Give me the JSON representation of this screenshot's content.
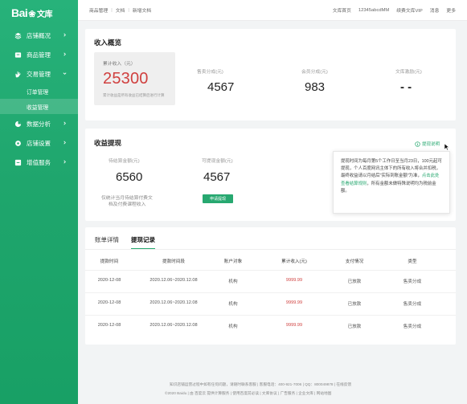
{
  "brand": {
    "logo_left": "Bai",
    "logo_paw": "❀",
    "logo_right": "文库"
  },
  "sidebar": {
    "items": [
      {
        "label": "店铺概况",
        "icon": "layers-icon",
        "has_caret": true
      },
      {
        "label": "商品管理",
        "icon": "box-icon",
        "has_caret": true
      },
      {
        "label": "交易管理",
        "icon": "hand-icon",
        "has_caret": true,
        "expanded": true,
        "children": [
          {
            "label": "订单管理",
            "active": false
          },
          {
            "label": "收益管理",
            "active": true
          }
        ]
      },
      {
        "label": "数据分析",
        "icon": "chart-icon",
        "has_caret": true
      },
      {
        "label": "店铺设置",
        "icon": "settings-icon",
        "has_caret": true
      },
      {
        "label": "增值服务",
        "icon": "grid-icon",
        "has_caret": true
      }
    ]
  },
  "topbar": {
    "breadcrumb": [
      "商品管理",
      "文档",
      "新增文档"
    ],
    "links": [
      "文库首页",
      "12345abcdMM",
      "续费文库VIP",
      "消息",
      "更多"
    ]
  },
  "overview": {
    "title": "收入概览",
    "total_label": "累计收入（元）",
    "total_value": "25300",
    "total_note": "累计收益是所有收益已结算后进行计算",
    "stats": [
      {
        "label": "售卖分成(元)",
        "value": "4567"
      },
      {
        "label": "会员分成(元)",
        "value": "983"
      },
      {
        "label": "文库激励(元)",
        "value": "- -"
      }
    ]
  },
  "withdraw": {
    "title": "收益提现",
    "tip_link": "提现说明",
    "pending_label": "待结算金额(元)",
    "pending_value": "6560",
    "pending_note_1": "仅统计当月待结算付费文",
    "pending_note_2": "档及付费课程收入",
    "available_label": "可提现金额(元)",
    "available_value": "4567",
    "apply_button": "申请提现",
    "tip_text_1": "提现时间为每月第5个工作日至当月23日，100元起可提现，个人百度网讯主体下的所有收入将合并扣税，最终收益请以月结后\"实际到账金额\"为准，",
    "tip_link_text": "点击此处查看结算规则",
    "tip_text_2": "，所有金额未做特殊说明均为税前金额。"
  },
  "records": {
    "tabs": [
      {
        "label": "账单详情",
        "active": false
      },
      {
        "label": "提现记录",
        "active": true
      }
    ],
    "columns": [
      "提款时间",
      "提款时间段",
      "账户对象",
      "累计收入(元)",
      "支付情况",
      "类型"
    ],
    "rows": [
      [
        "2020-12-08",
        "2020.12.06~2020.12.08",
        "机构",
        "9999.99",
        "已放款",
        "售卖分成"
      ],
      [
        "2020-12-08",
        "2020.12.06~2020.12.08",
        "机构",
        "9999.99",
        "已放款",
        "售卖分成"
      ],
      [
        "2020-12-08",
        "2020.12.06~2020.12.08",
        "机构",
        "9999.99",
        "已放款",
        "售卖分成"
      ]
    ]
  },
  "footer": {
    "line1": "知识店铺运营过程中如有任何问题，请随时联系客服   |   客服电话：400-921-7006   |   QQ：800049878   |   在线反馈",
    "line2": "©2020 Baidu  |  由 百度云 提供计算服务  |  使用百度前必读  |  文库协议  |  广告服务  |  企业文库  |  网站地图"
  },
  "colors": {
    "accent": "#27a870",
    "red": "#d0403f",
    "sidebar": "#1fa66d"
  }
}
